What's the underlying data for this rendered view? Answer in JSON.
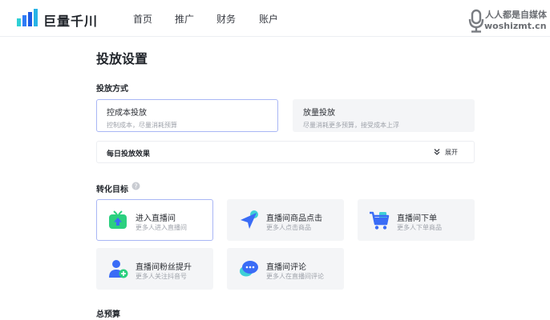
{
  "header": {
    "logo_text": "巨量千川",
    "nav": [
      "首页",
      "推广",
      "财务",
      "账户"
    ],
    "watermark": {
      "line1": "人人都是自媒体",
      "line2": "woshizmt.cn"
    }
  },
  "page": {
    "title": "投放设置",
    "delivery_mode": {
      "title": "投放方式",
      "options": [
        {
          "title": "控成本投放",
          "desc": "控制成本，尽量消耗预算",
          "selected": true
        },
        {
          "title": "放量投放",
          "desc": "尽量消耗更多预算，接受成本上浮",
          "selected": false
        }
      ]
    },
    "daily_effect": {
      "label": "每日投放效果",
      "expand_label": "展开",
      "expand_icon": "double-chevron-down-icon"
    },
    "conversion_goal": {
      "title": "转化目标",
      "help_icon": "question-circle-icon",
      "options": [
        {
          "title": "进入直播间",
          "desc": "更多人进入直播间",
          "icon": "tv-enter-icon",
          "selected": true
        },
        {
          "title": "直播间商品点击",
          "desc": "更多人点击商品",
          "icon": "cursor-click-icon",
          "selected": false
        },
        {
          "title": "直播间下单",
          "desc": "更多人下单商品",
          "icon": "shopping-cart-icon",
          "selected": false
        },
        {
          "title": "直播间粉丝提升",
          "desc": "更多人关注抖音号",
          "icon": "user-add-icon",
          "selected": false
        },
        {
          "title": "直播间评论",
          "desc": "更多人在直播间评论",
          "icon": "chat-bubble-icon",
          "selected": false
        }
      ]
    },
    "total_budget": {
      "title": "总预算"
    }
  },
  "colors": {
    "accent_border": "#a9b6f5",
    "card_bg": "#f4f5f7",
    "icon_blue": "#3a6cf6",
    "icon_cyan": "#3fd0d6",
    "icon_green": "#2bd07f"
  }
}
